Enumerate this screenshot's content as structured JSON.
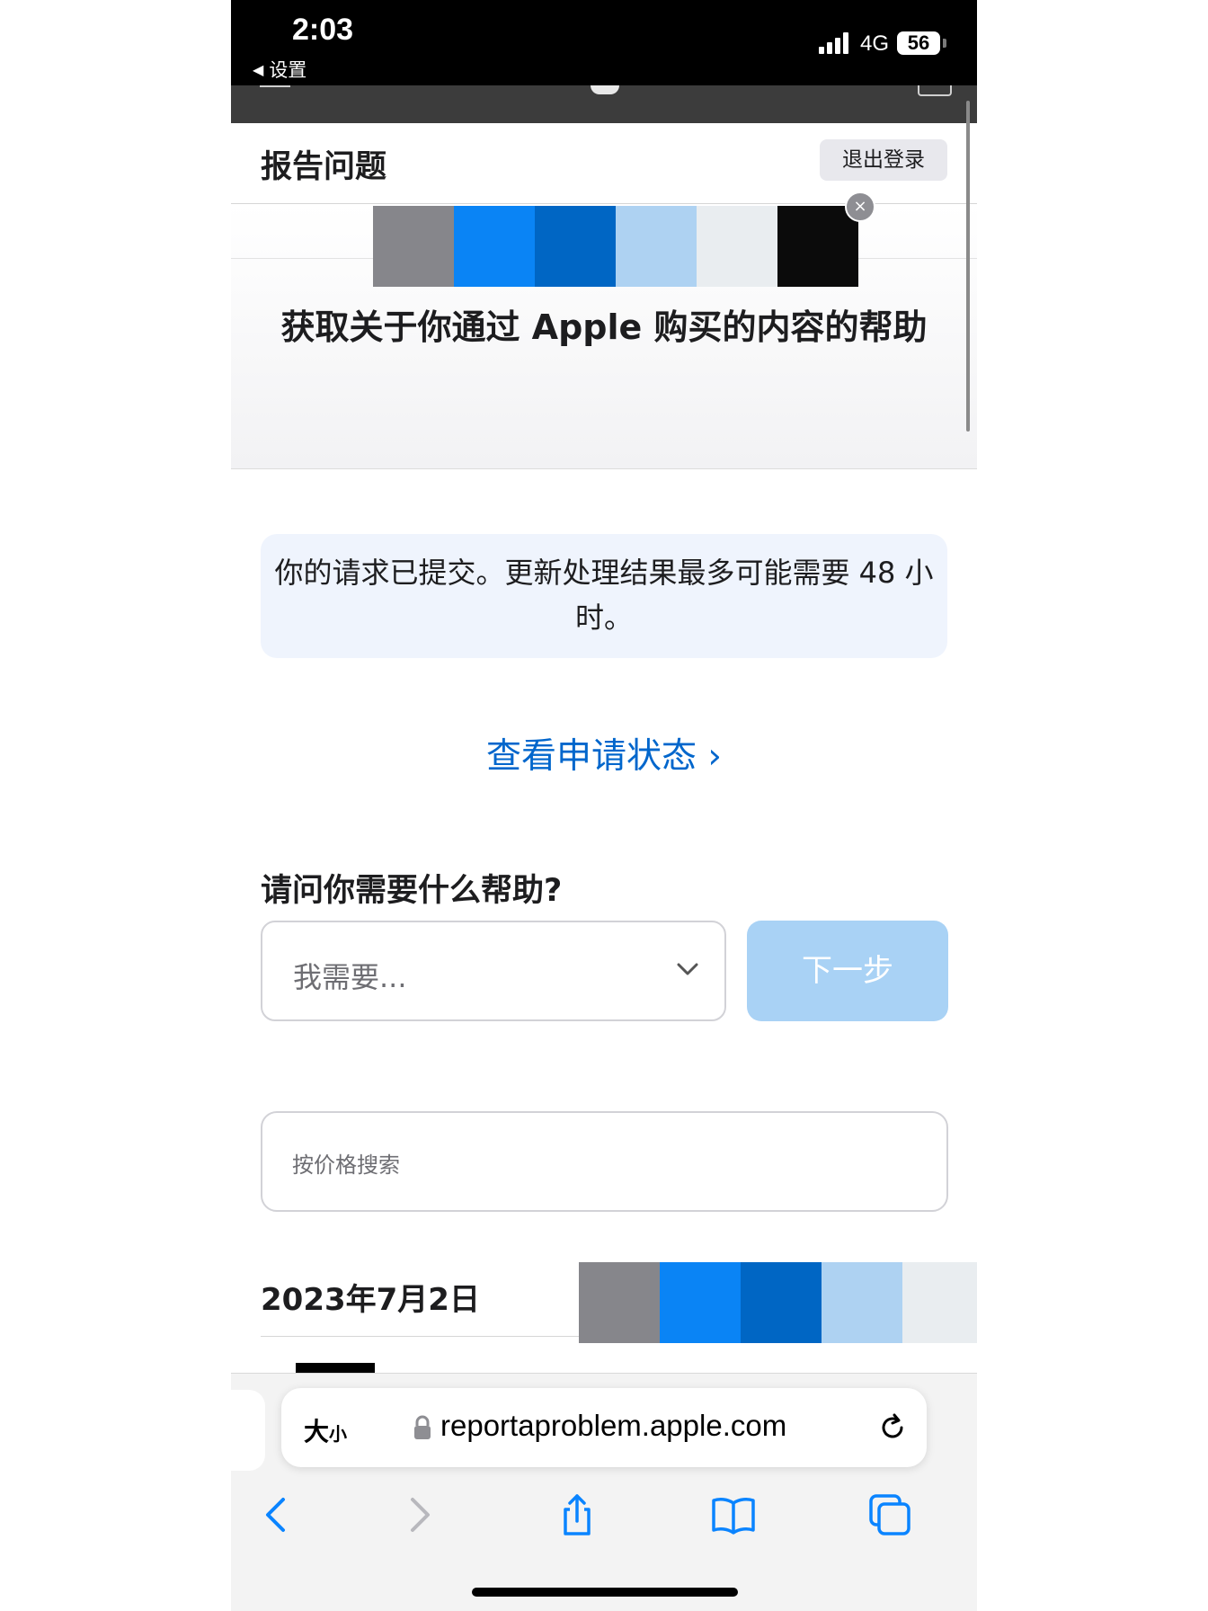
{
  "status_bar": {
    "time": "2:03",
    "back_label": "设置",
    "network": "4G",
    "battery": "56"
  },
  "local_nav": {
    "title": "报告问题",
    "sign_out": "退出登录"
  },
  "hero": {
    "title": "获取关于你通过 Apple 购买的内容的帮助"
  },
  "notice": {
    "text": "你的请求已提交。更新处理结果最多可能需要 48 小时。"
  },
  "status_link": {
    "label": "查看申请状态 ›"
  },
  "help": {
    "question": "请问你需要什么帮助?",
    "select_placeholder": "我需要...",
    "next_button": "下一步"
  },
  "search": {
    "placeholder": "按价格搜索"
  },
  "purchases": {
    "date": "2023年7月2日"
  },
  "browser": {
    "text_size_big": "大",
    "text_size_small": "小",
    "url": "reportaproblem.apple.com"
  },
  "colors": {
    "link": "#0066cc",
    "next_button_bg": "#a9d2f5",
    "notice_bg": "#eff4fd",
    "swatches": [
      "#86868b",
      "#0a84f5",
      "#0066c4",
      "#aed2f2",
      "#e9edf0",
      "#0b0b0b"
    ]
  },
  "icons": {
    "close": "×",
    "back": "chevron-left",
    "forward": "chevron-right",
    "share": "share",
    "bookmarks": "book",
    "tabs": "tabs",
    "reload": "reload",
    "lock": "lock"
  }
}
